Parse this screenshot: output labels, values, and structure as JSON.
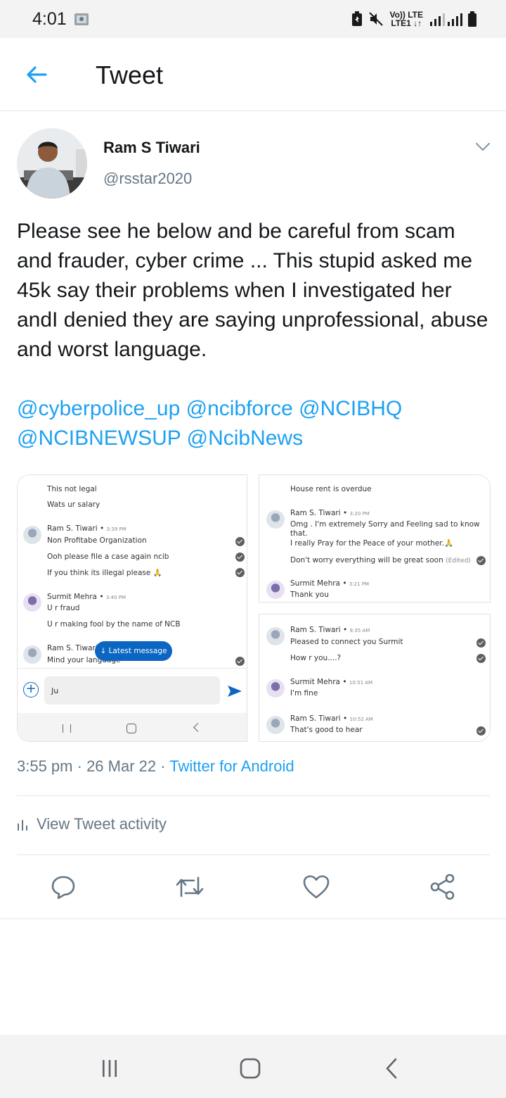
{
  "status_bar": {
    "time": "4:01",
    "volte_top": "Vo)) LTE",
    "volte_bottom": "LTE1 ↓↑",
    "icons": [
      "notification-icon",
      "battery-saver-icon",
      "mute-icon",
      "signal-icon",
      "battery-icon"
    ]
  },
  "header": {
    "title": "Tweet",
    "back_icon": "arrow-left-icon"
  },
  "tweet": {
    "author_name": "Ram S Tiwari",
    "author_handle": "@rsstar2020",
    "text": "Please see he below and be careful from scam and frauder, cyber crime ... This stupid asked me 45k say their problems when I investigated her andI denied they are saying unprofessional, abuse and worst language.",
    "mentions": [
      "@cyberpolice_up",
      "@ncibforce",
      "@NCIBHQ",
      "@NCIBNEWSUP",
      "@NcibNews"
    ],
    "time": "3:55 pm",
    "date": "26 Mar 22",
    "source": "Twitter for Android",
    "activity_label": "View Tweet activity"
  },
  "media": {
    "left": {
      "lines": [
        "This not legal",
        "Wats ur salary",
        "Non Profitabe Organization",
        "Ooh please file a case again ncib",
        "If you think its illegal please 🙏",
        "U r fraud",
        "U r making fool by the name of NCB",
        "Mind your language"
      ],
      "name1": "Ram S. Tiwari",
      "time1": "3:39 PM",
      "name2": "Surmit Mehra",
      "time2": "3:40 PM",
      "name3": "Ram S. Tiwari",
      "latest_pill": "↓ Latest message",
      "input_value": "Ju"
    },
    "right_top": {
      "lines": [
        "House rent is overdue",
        "Omg . I'm extremely Sorry and Feeling sad to know",
        "that.",
        "I really Pray for the Peace of your mother.🙏",
        "Don't worry everything will be great soon",
        "Thank you"
      ],
      "edited": "(Edited)",
      "name1": "Ram S. Tiwari",
      "time1": "3:20 PM",
      "name2": "Surmit Mehra",
      "time2": "3:21 PM"
    },
    "right_bottom": {
      "lines": [
        "Pleased to connect you Surmit",
        "How r you....?",
        "I'm fine",
        "That's good to hear"
      ],
      "name1": "Ram S. Tiwari",
      "time1": "9:35 AM",
      "name2": "Surmit Mehra",
      "time2": "10:51 AM",
      "name3": "Ram S. Tiwari",
      "time3": "10:52 AM"
    }
  },
  "actions": [
    "reply-icon",
    "retweet-icon",
    "like-icon",
    "share-icon"
  ],
  "colors": {
    "accent": "#1da1f2",
    "text": "#14171a",
    "secondary": "#657786",
    "divider": "#e1e8ed"
  }
}
